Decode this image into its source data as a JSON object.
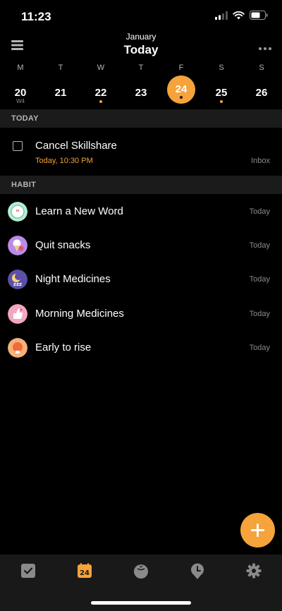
{
  "status_bar": {
    "time": "11:23"
  },
  "header": {
    "month": "January",
    "title": "Today"
  },
  "week": {
    "days": [
      {
        "dow": "M",
        "num": "20",
        "week_label": "W4",
        "dot": false,
        "selected": false
      },
      {
        "dow": "T",
        "num": "21",
        "dot": false,
        "selected": false
      },
      {
        "dow": "W",
        "num": "22",
        "dot": true,
        "selected": false
      },
      {
        "dow": "T",
        "num": "23",
        "dot": false,
        "selected": false
      },
      {
        "dow": "F",
        "num": "24",
        "dot": true,
        "selected": true
      },
      {
        "dow": "S",
        "num": "25",
        "dot": true,
        "selected": false
      },
      {
        "dow": "S",
        "num": "26",
        "dot": false,
        "selected": false
      }
    ]
  },
  "sections": {
    "today": "TODAY",
    "habit": "HABIT"
  },
  "task": {
    "title": "Cancel Skillshare",
    "due": "Today, 10:30 PM",
    "list": "Inbox"
  },
  "habits": [
    {
      "label": "Learn a New Word",
      "date": "Today",
      "icon": "quote-bubble-icon",
      "color": "#b7ecd4"
    },
    {
      "label": "Quit snacks",
      "date": "Today",
      "icon": "ice-cream-icon",
      "color": "#b98be8"
    },
    {
      "label": "Night Medicines",
      "date": "Today",
      "icon": "moon-zzz-icon",
      "color": "#5b4fa6"
    },
    {
      "label": "Morning Medicines",
      "date": "Today",
      "icon": "thumbs-up-icon",
      "color": "#f1a7bf"
    },
    {
      "label": "Early to rise",
      "date": "Today",
      "icon": "sunrise-icon",
      "color": "#f4b27a"
    }
  ],
  "tab_bar": {
    "calendar_day": "24",
    "tabs": [
      {
        "name": "tab-tasks",
        "icon": "checkbox-icon"
      },
      {
        "name": "tab-calendar",
        "icon": "calendar-icon"
      },
      {
        "name": "tab-pomodoro",
        "icon": "tomato-icon"
      },
      {
        "name": "tab-habit-timer",
        "icon": "clock-pin-icon"
      },
      {
        "name": "tab-settings",
        "icon": "gear-icon"
      }
    ]
  },
  "colors": {
    "accent": "#f5a33a",
    "background": "#000000",
    "section_bg": "#1b1b1b",
    "muted": "#8a8a8a"
  }
}
